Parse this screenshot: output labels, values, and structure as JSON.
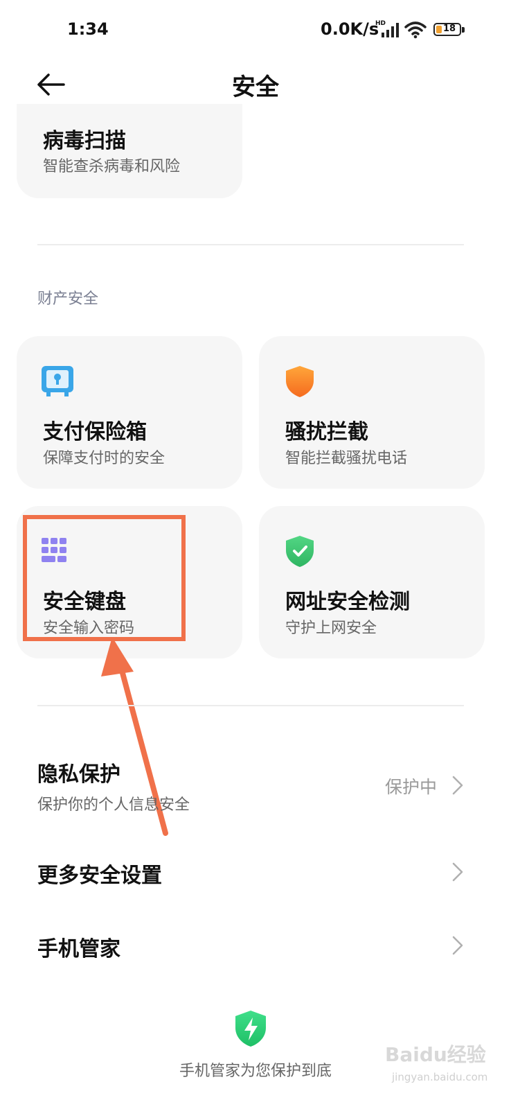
{
  "status_bar": {
    "time": "1:34",
    "network_speed": "0.0K/s",
    "hd_label": "HD",
    "battery_level": "18",
    "icons": [
      "signal-icon",
      "wifi-icon",
      "battery-icon"
    ]
  },
  "header": {
    "title": "安全",
    "back_icon": "back-arrow-icon"
  },
  "virus_scan": {
    "title": "病毒扫描",
    "subtitle": "智能查杀病毒和风险"
  },
  "property_section": {
    "label": "财产安全",
    "cards": [
      {
        "title": "支付保险箱",
        "subtitle": "保障支付时的安全",
        "icon": "safe-box-icon",
        "color": "#3aa6e8"
      },
      {
        "title": "骚扰拦截",
        "subtitle": "智能拦截骚扰电话",
        "icon": "shield-icon",
        "color": "#f7902a"
      },
      {
        "title": "安全键盘",
        "subtitle": "安全输入密码",
        "icon": "keyboard-icon",
        "color": "#8f82f0"
      },
      {
        "title": "网址安全检测",
        "subtitle": "守护上网安全",
        "icon": "check-shield-icon",
        "color": "#3cc46e"
      }
    ]
  },
  "list": [
    {
      "title": "隐私保护",
      "subtitle": "保护你的个人信息安全",
      "status": "保护中"
    },
    {
      "title": "更多安全设置"
    },
    {
      "title": "手机管家"
    }
  ],
  "footer": {
    "text": "手机管家为您保护到底",
    "icon": "lightning-shield-icon",
    "color": "#2fcf77"
  },
  "watermark": {
    "text": "Baidu经验",
    "url_text": "jingyan.baidu.com"
  },
  "annotation": {
    "color": "#f0714a"
  }
}
